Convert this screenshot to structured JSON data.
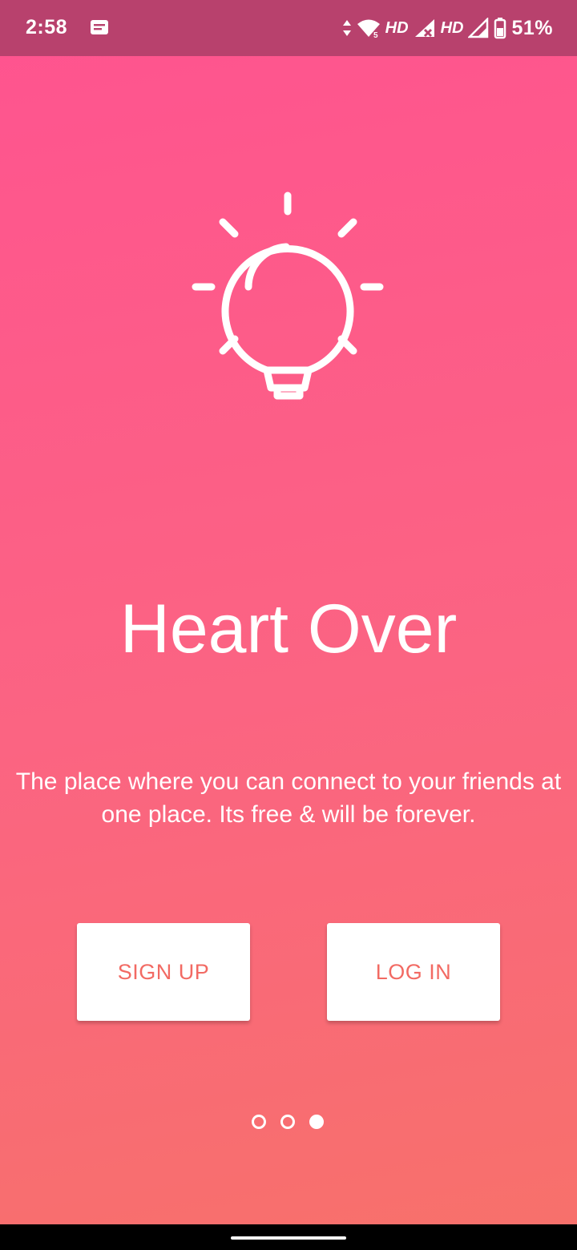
{
  "status_bar": {
    "time": "2:58",
    "network_label_1": "HD",
    "network_label_2": "HD",
    "wifi_badge": "5",
    "battery": "51%"
  },
  "app": {
    "title": "Heart Over",
    "tagline": "The place where you can connect to your friends at one place. Its free & will be forever."
  },
  "buttons": {
    "signup": "SIGN UP",
    "login": "LOG IN"
  },
  "pager": {
    "total": 3,
    "current": 3
  },
  "colors": {
    "gradient_top": "#ff5390",
    "gradient_bottom": "#f7716a",
    "status_bar": "#b8416d",
    "button_text": "#f26a63"
  },
  "icons": {
    "hero": "lightbulb-icon",
    "notification": "message-icon"
  }
}
